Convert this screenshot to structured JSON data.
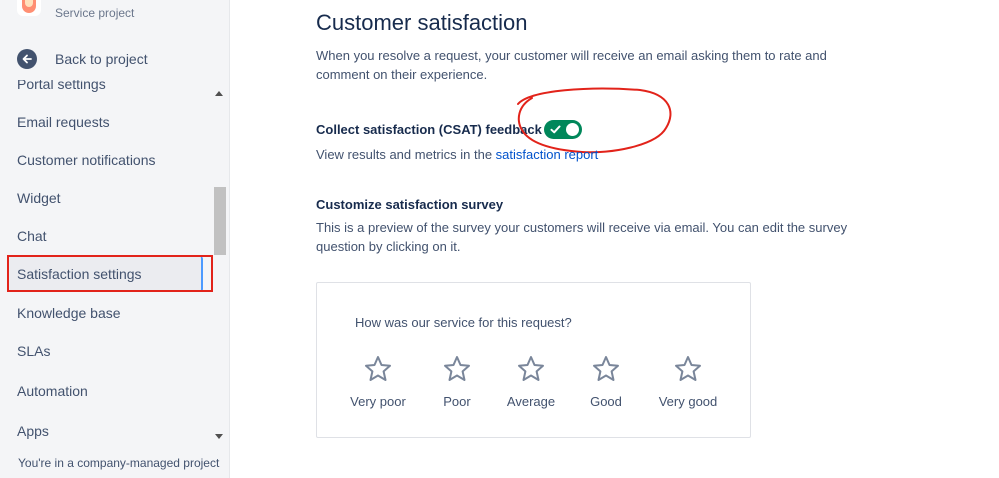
{
  "sidebar": {
    "project_subtitle": "Service project",
    "back_label": "Back to project",
    "items": [
      {
        "label": "Portal settings",
        "active": false
      },
      {
        "label": "Email requests",
        "active": false
      },
      {
        "label": "Customer notifications",
        "active": false
      },
      {
        "label": "Widget",
        "active": false
      },
      {
        "label": "Chat",
        "active": false
      },
      {
        "label": "Satisfaction settings",
        "active": true
      },
      {
        "label": "Knowledge base",
        "active": false
      },
      {
        "label": "SLAs",
        "active": false
      },
      {
        "label": "Automation",
        "active": false
      },
      {
        "label": "Apps",
        "active": false
      }
    ],
    "footer": "You're in a company-managed project"
  },
  "main": {
    "title": "Customer satisfaction",
    "intro": "When you resolve a request, your customer will receive an email asking them to rate and comment on their experience.",
    "csat": {
      "label": "Collect satisfaction (CSAT) feedback",
      "enabled": true
    },
    "results": {
      "prefix": "View results and metrics in the ",
      "link": "satisfaction report"
    },
    "customize": {
      "title": "Customize satisfaction survey",
      "description": "This is a preview of the survey your customers will receive via email. You can edit the survey question by clicking on it."
    },
    "survey": {
      "question": "How was our service for this request?",
      "ratings": [
        "Very poor",
        "Poor",
        "Average",
        "Good",
        "Very good"
      ]
    }
  },
  "colors": {
    "toggle_on": "#00875A",
    "link": "#0052CC",
    "annotation": "#E2231A",
    "sidebar_bg": "#F4F5F7"
  },
  "icons": [
    "project-avatar-icon",
    "back-arrow-icon",
    "check-icon",
    "star-icon"
  ]
}
